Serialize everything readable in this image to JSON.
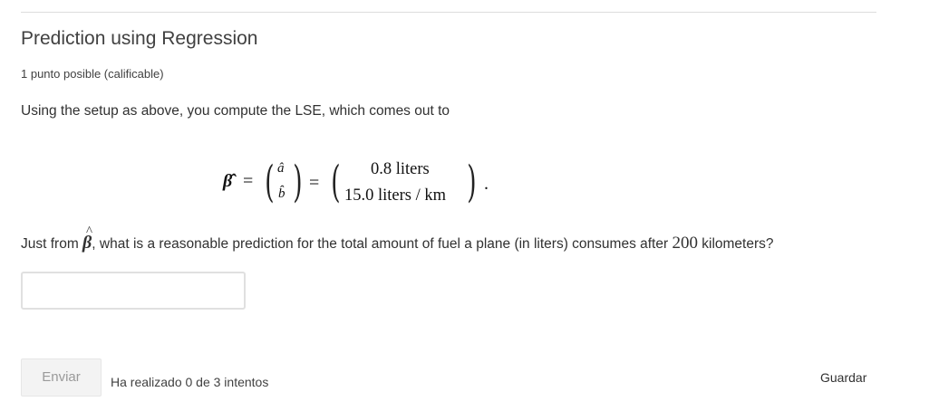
{
  "problem": {
    "title": "Prediction using Regression",
    "points": "1 punto posible (calificable)",
    "prompt": "Using the setup as above, you compute the LSE, which comes out to",
    "formula": {
      "beta_hat": "β̂",
      "equals": "=",
      "a_hat": "â",
      "b_hat": "b̂",
      "value_top": "0.8 liters",
      "value_bottom": "15.0 liters / km",
      "period": "."
    },
    "question_pre": "Just from ",
    "question_beta": "β",
    "question_hat": "^",
    "question_mid": ", what is a reasonable prediction for the total amount of fuel a plane (in liters) consumes after ",
    "question_number": "200",
    "question_post": " kilometers?"
  },
  "answer": {
    "value": "",
    "placeholder": ""
  },
  "actions": {
    "submit_label": "Enviar",
    "attempts_text": "Ha realizado 0 de 3 intentos",
    "save_label": "Guardar"
  }
}
